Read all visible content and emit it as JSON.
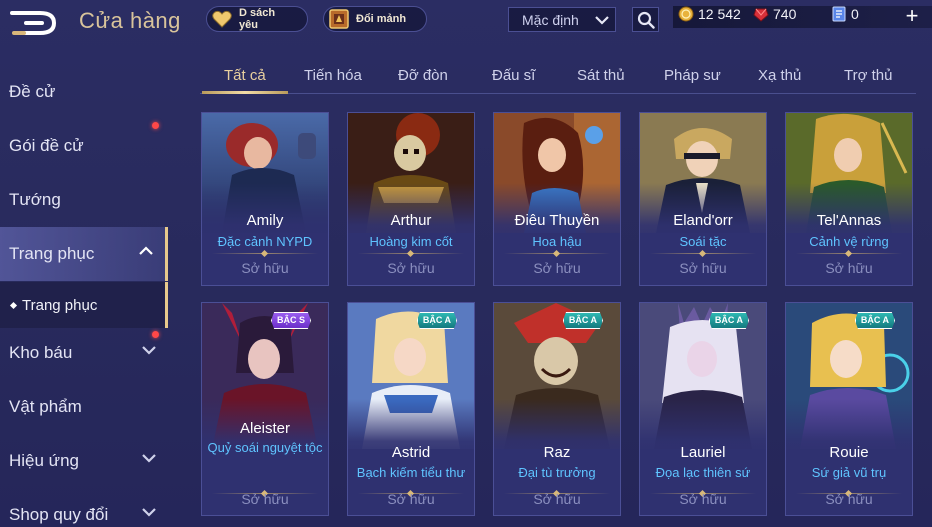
{
  "header": {
    "title": "Cửa hàng",
    "favorites_label": "D sách yêu",
    "exchange_label": "Đổi mảnh",
    "sort": {
      "selected": "Mặc định"
    },
    "currency": {
      "gold": "12 542",
      "ruby": "740",
      "vouchers": "0"
    },
    "plus_label": "+"
  },
  "sidebar": {
    "items": [
      {
        "label": "Đề cử"
      },
      {
        "label": "Gói đề cử"
      },
      {
        "label": "Tướng"
      },
      {
        "label": "Trang phục"
      },
      {
        "label": "Kho báu"
      },
      {
        "label": "Vật phẩm"
      },
      {
        "label": "Hiệu ứng"
      },
      {
        "label": "Shop quy đổi"
      }
    ],
    "sub_item": "Trang phục"
  },
  "tabs": [
    {
      "label": "Tất cả"
    },
    {
      "label": "Tiến hóa"
    },
    {
      "label": "Đỡ đòn"
    },
    {
      "label": "Đấu sĩ"
    },
    {
      "label": "Sát thủ"
    },
    {
      "label": "Pháp sư"
    },
    {
      "label": "Xạ thủ"
    },
    {
      "label": "Trợ thủ"
    }
  ],
  "cards": [
    {
      "hero": "Amily",
      "skin": "Đặc cảnh NYPD",
      "status": "Sở hữu"
    },
    {
      "hero": "Arthur",
      "skin": "Hoàng kim cốt",
      "status": "Sở hữu"
    },
    {
      "hero": "Điêu Thuyền",
      "skin": "Hoa hậu",
      "status": "Sở hữu"
    },
    {
      "hero": "Eland'orr",
      "skin": "Soái tặc",
      "status": "Sở hữu"
    },
    {
      "hero": "Tel'Annas",
      "skin": "Cảnh vệ rừng",
      "status": "Sở hữu"
    },
    {
      "hero": "Aleister",
      "skin": "Quỷ soái nguyệt tộc",
      "status": "Sở hữu",
      "badge": "BẬC S"
    },
    {
      "hero": "Astrid",
      "skin": "Bạch kiếm tiểu thư",
      "status": "Sở hữu",
      "badge": "BẬC A"
    },
    {
      "hero": "Raz",
      "skin": "Đại tù trưởng",
      "status": "Sở hữu",
      "badge": "BẬC A"
    },
    {
      "hero": "Lauriel",
      "skin": "Đọa lạc thiên sứ",
      "status": "Sở hữu",
      "badge": "BẬC A"
    },
    {
      "hero": "Rouie",
      "skin": "Sứ giả vũ trụ",
      "status": "Sở hữu",
      "badge": "BẬC A"
    }
  ],
  "colors": {
    "accent_gold": "#e8cf9f",
    "skin_name_blue": "#5fc4ff",
    "badge_s": "#7b3fe0",
    "badge_a": "#1f9a98",
    "notification_dot": "#ff4848"
  }
}
